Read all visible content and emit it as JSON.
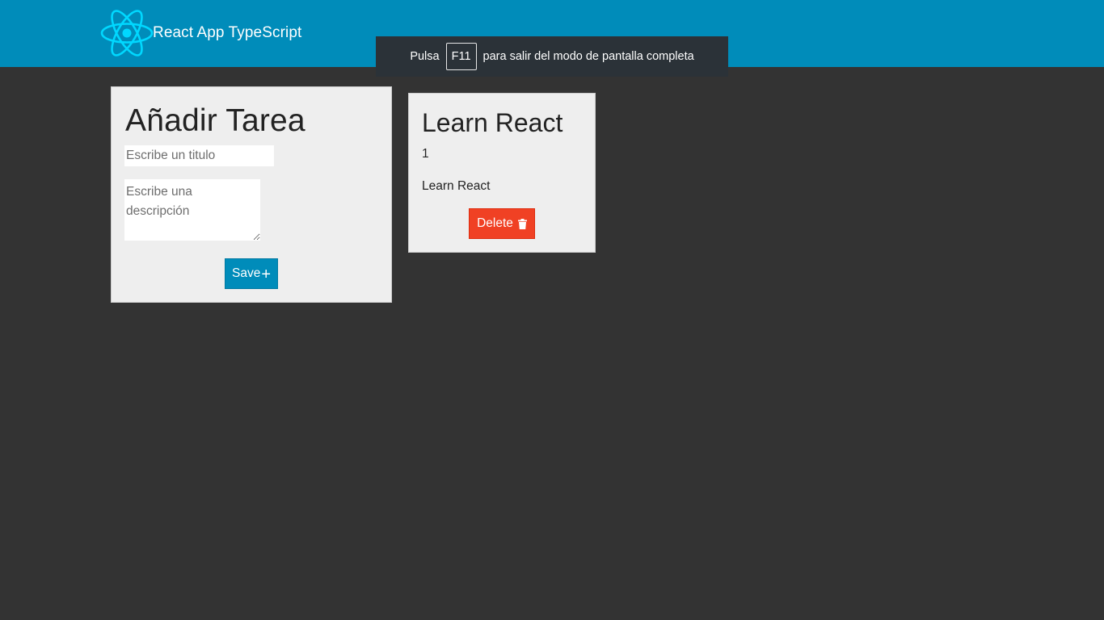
{
  "navbar": {
    "brand_title": "React App TypeScript",
    "logo_icon": "react-atom-icon",
    "logo_color": "#00d8ff",
    "background": "#008cba"
  },
  "fullscreen_notice": {
    "before": "Pulsa",
    "key": "F11",
    "after": "para salir del modo de pantalla completa"
  },
  "add_task": {
    "heading": "Añadir Tarea",
    "title_placeholder": "Escribe un titulo",
    "title_value": "",
    "description_placeholder": "Escribe una descripción",
    "description_value": "",
    "save_label": "Save",
    "save_icon": "plus-icon"
  },
  "tasks": [
    {
      "title": "Learn React",
      "id": "1",
      "description": "Learn React",
      "delete_label": "Delete",
      "delete_icon": "trash-icon"
    }
  ],
  "colors": {
    "primary": "#008cba",
    "danger": "#f04124",
    "page_background": "#333333",
    "card_background": "#eeeeee"
  }
}
